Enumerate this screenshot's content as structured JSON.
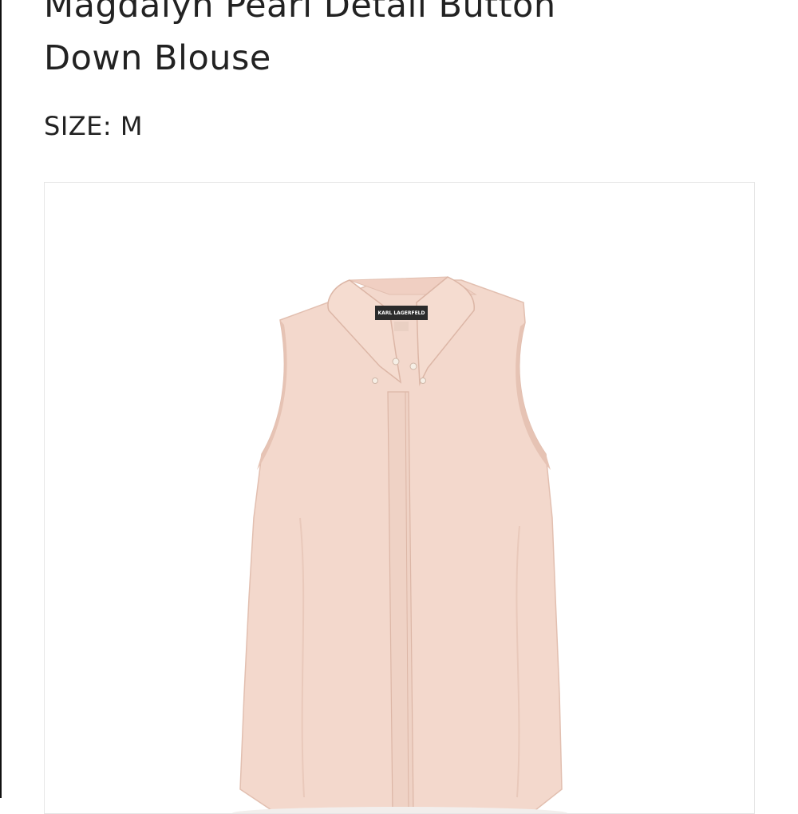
{
  "product": {
    "title_line1": "Magdalyn Pearl Detail Button",
    "title_line2": "Down Blouse",
    "size": "SIZE: M"
  },
  "image": {
    "brand_label": "KARL LAGERFELD",
    "colors": {
      "fabric": "#f3d8cc",
      "fabric_shade": "#e6c3b4",
      "pearl": "#f6efe6",
      "label": "#2b2b2b"
    }
  }
}
